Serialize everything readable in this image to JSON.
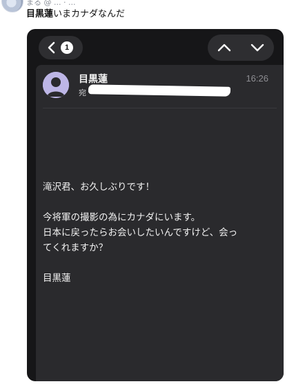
{
  "post": {
    "meta": "まる @ ... · ... ",
    "name_bold": "目黒蓮",
    "text_rest": "いまカナダなんだ"
  },
  "mail_ui": {
    "unread_count": "1",
    "sender_name": "目黒蓮",
    "recipient_label": "宛",
    "time": "16:26",
    "body": {
      "line1": "滝沢君、お久しぶりです！",
      "line2": "今将軍の撮影の為にカナダにいます。",
      "line3": "日本に戻ったらお会いしたいんですけど、会っ",
      "line4": "てくれますか？",
      "signature": "目黒蓮"
    }
  },
  "colors": {
    "phone_bg": "#161618",
    "card_bg": "#2a2a2d",
    "pill_bg": "#2e2e31",
    "avatar_bg": "#c0b8e8"
  }
}
